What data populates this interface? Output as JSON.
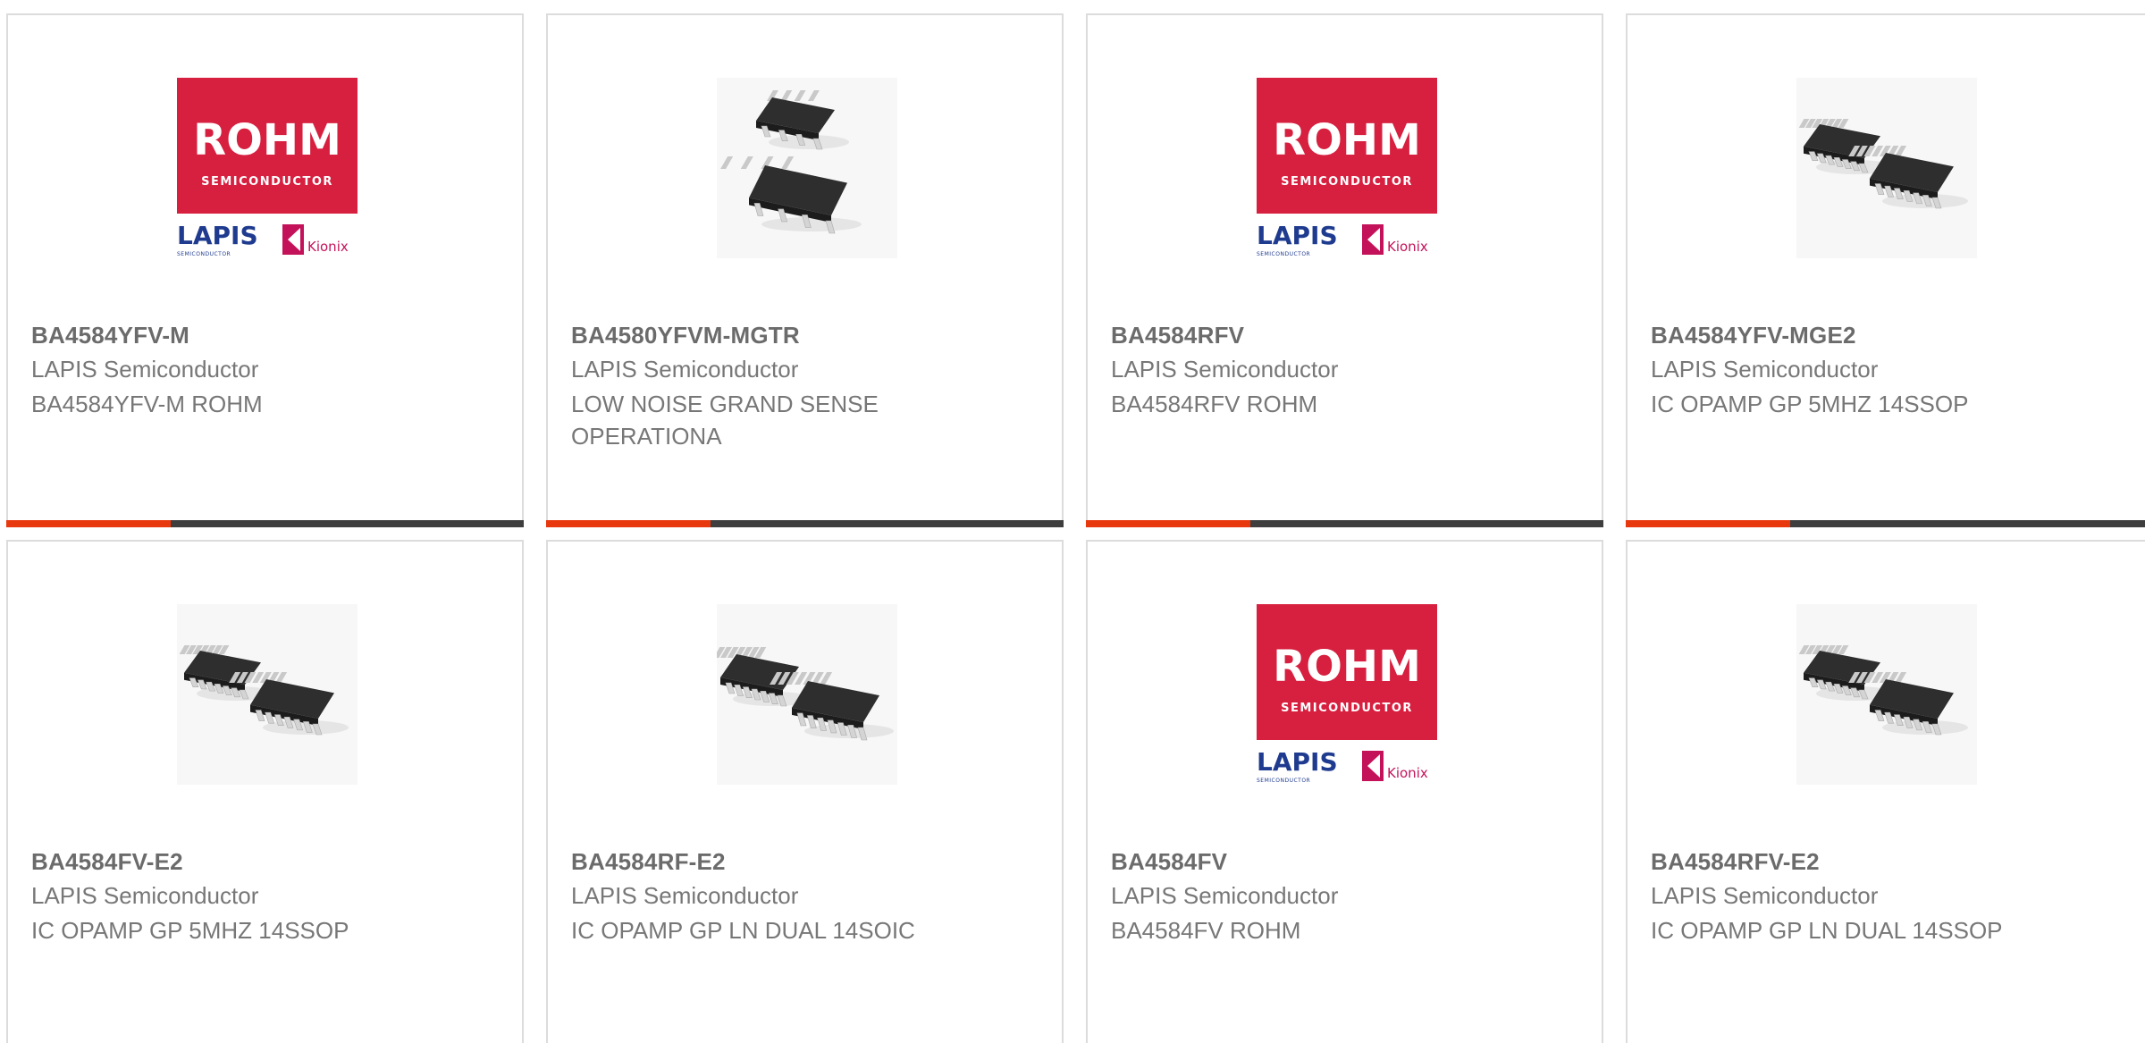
{
  "products": [
    {
      "part_number": "BA4584YFV-M",
      "manufacturer": "LAPIS Semiconductor",
      "description": "BA4584YFV-M ROHM",
      "image": "rohm-logo",
      "logo": {
        "brand": "ROHM",
        "sub": "SEMICONDUCTOR",
        "lapis": "LAPIS",
        "lapis_sub": "SEMICONDUCTOR",
        "kionix": "Kionix"
      }
    },
    {
      "part_number": "BA4580YFVM-MGTR",
      "manufacturer": "LAPIS Semiconductor",
      "description": "LOW NOISE GRAND SENSE OPERATIONA",
      "image": "chip-msop8"
    },
    {
      "part_number": "BA4584RFV",
      "manufacturer": "LAPIS Semiconductor",
      "description": "BA4584RFV ROHM",
      "image": "rohm-logo",
      "logo": {
        "brand": "ROHM",
        "sub": "SEMICONDUCTOR",
        "lapis": "LAPIS",
        "lapis_sub": "SEMICONDUCTOR",
        "kionix": "Kionix"
      }
    },
    {
      "part_number": "BA4584YFV-MGE2",
      "manufacturer": "LAPIS Semiconductor",
      "description": "IC OPAMP GP 5MHZ 14SSOP",
      "image": "chip-ssop14"
    },
    {
      "part_number": "BA4584FV-E2",
      "manufacturer": "LAPIS Semiconductor",
      "description": "IC OPAMP GP 5MHZ 14SSOP",
      "image": "chip-ssop14"
    },
    {
      "part_number": "BA4584RF-E2",
      "manufacturer": "LAPIS Semiconductor",
      "description": "IC OPAMP GP LN DUAL 14SOIC",
      "image": "chip-soic14"
    },
    {
      "part_number": "BA4584FV",
      "manufacturer": "LAPIS Semiconductor",
      "description": "BA4584FV ROHM",
      "image": "rohm-logo",
      "logo": {
        "brand": "ROHM",
        "sub": "SEMICONDUCTOR",
        "lapis": "LAPIS",
        "lapis_sub": "SEMICONDUCTOR",
        "kionix": "Kionix"
      }
    },
    {
      "part_number": "BA4584RFV-E2",
      "manufacturer": "LAPIS Semiconductor",
      "description": "IC OPAMP GP LN DUAL 14SSOP",
      "image": "chip-ssop14"
    }
  ],
  "colors": {
    "accent": "#e8380d",
    "bar": "#3e3e3e",
    "rohm_red": "#d71f3f",
    "lapis_blue": "#1f3b8f",
    "kionix_pink": "#c4125a"
  }
}
